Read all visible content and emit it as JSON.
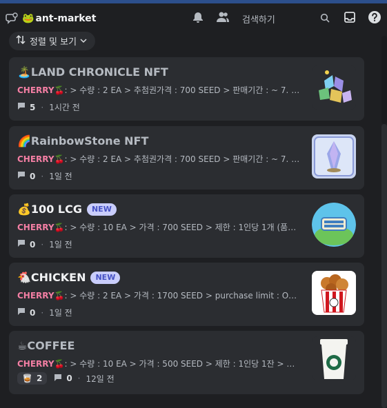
{
  "header": {
    "channel_emoji": "🐸",
    "channel_name": "ant-market",
    "search_placeholder": "검색하기"
  },
  "sort": {
    "label": "정렬 및 보기"
  },
  "posts": [
    {
      "emoji": "🏝️",
      "title": "LAND CHRONICLE NFT",
      "is_new": false,
      "author": "CHERRY🍒",
      "message": ": > 수량 : 2 EA > 추첨권가격 : 700 SEED > 판매기간 : ~ 7. 31.",
      "reaction": null,
      "comment_count": "5",
      "time": "1시간 전"
    },
    {
      "emoji": "🌈",
      "title": "RainbowStone NFT",
      "is_new": false,
      "author": "CHERRY🍒",
      "message": ": > 수량 : 2 EA > 추첨권가격 : 700 SEED > 판매기간 : ~ 7. 31.",
      "reaction": null,
      "comment_count": "0",
      "time": "1일 전"
    },
    {
      "emoji": "💰",
      "title": "100 LCG",
      "is_new": true,
      "new_label": "NEW",
      "author": "CHERRY🍒",
      "message": ": > 수량 : 10 EA > 가격 : 700 SEED > 제한 : 1인당 1개 (품절시 판매 종료)",
      "reaction": null,
      "comment_count": "0",
      "time": "1일 전"
    },
    {
      "emoji": "🐔",
      "title": "CHICKEN",
      "is_new": true,
      "new_label": "NEW",
      "author": "CHERRY🍒",
      "message": ": > 수량 : 2 EA > 가격 : 1700 SEED > purchase limit : One per person",
      "reaction": null,
      "comment_count": "0",
      "time": "1일 전"
    },
    {
      "emoji": "☕",
      "title": "COFFEE",
      "is_new": false,
      "author": "CHERRY🍒",
      "message": ": > 수량 : 10 EA > 가격 : 500 SEED > 제한 : 1인당 1잔 > > purchase limit",
      "reaction": {
        "emoji": "🥃",
        "count": "2"
      },
      "comment_count": "0",
      "time": "12일 전"
    }
  ],
  "colors": {
    "background": "#1e1f22",
    "card": "#2b2d31",
    "author": "#f47fa4",
    "new_badge": "#c9cdfb",
    "top_strip": "#2c4f8c"
  }
}
